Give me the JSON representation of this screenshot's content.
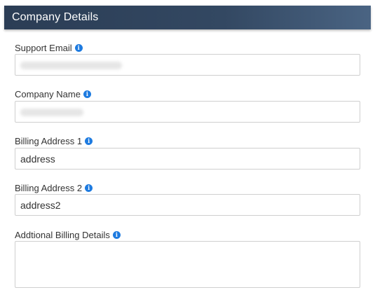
{
  "header": {
    "title": "Company Details"
  },
  "fields": {
    "support_email": {
      "label": "Support Email",
      "value": ""
    },
    "company_name": {
      "label": "Company Name",
      "value": ""
    },
    "billing_address_1": {
      "label": "Billing Address 1",
      "value": "address"
    },
    "billing_address_2": {
      "label": "Billing Address 2",
      "value": "address2"
    },
    "additional_billing_details": {
      "label": "Addtional Billing Details",
      "value": ""
    }
  },
  "icons": {
    "info": "info-icon",
    "info_glyph": "i"
  },
  "colors": {
    "header_bg": "#334862",
    "info_icon": "#1e7be0",
    "input_border": "#cfcfcf"
  }
}
